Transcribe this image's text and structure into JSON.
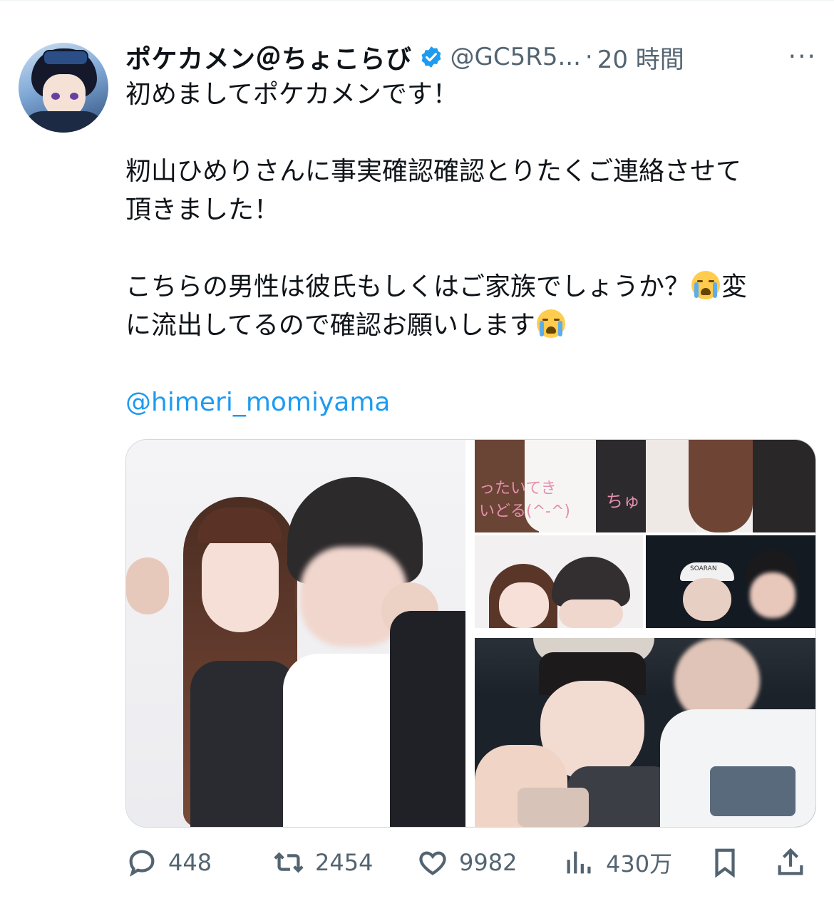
{
  "author": {
    "display_name": "ポケカメン＠ちょこらび",
    "handle": "@GC5R5...",
    "separator": "·",
    "time": "20 時間",
    "verified": true
  },
  "more_label": "···",
  "tweet": {
    "line1": "初めましてポケカメンです！",
    "line2": "籾山ひめりさんに事実確認確認とりたくご連絡させて",
    "line3": "頂きました！",
    "line4": "こちらの男性は彼氏もしくはご家族でしょうか？",
    "line4_tail": "変",
    "line5": "に流出してるので確認お願いします",
    "mention": "@himeri_momiyama"
  },
  "media": {
    "overlay_text_1": "ったいてき",
    "overlay_text_2": "いどる(^-^)",
    "overlay_text_3": "ちゅ",
    "cap_text": "SOARAN"
  },
  "actions": {
    "reply_count": "448",
    "retweet_count": "2454",
    "like_count": "9982",
    "views_count": "430万"
  },
  "colors": {
    "accent": "#1d9bf0",
    "secondary_text": "#536471",
    "primary_text": "#0f1419"
  }
}
